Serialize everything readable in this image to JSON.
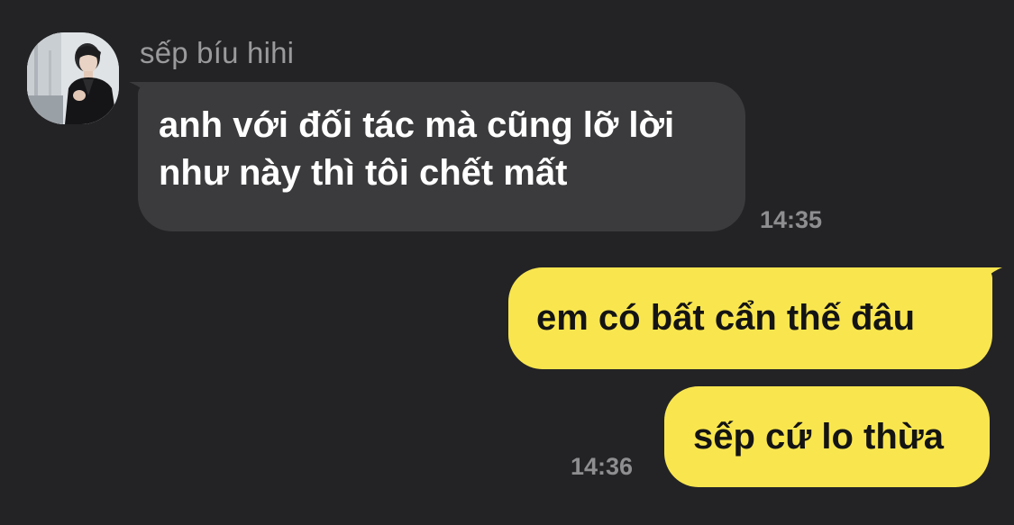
{
  "conversation": {
    "sender_name": "sếp bíu hihi",
    "messages": [
      {
        "direction": "incoming",
        "lines": [
          "anh với đối tác mà cũng lỡ lời",
          "như này thì tôi chết mất"
        ]
      },
      {
        "direction": "outgoing",
        "text": "em có bất cẩn thế đâu"
      },
      {
        "direction": "outgoing",
        "text": "sếp cứ lo thừa"
      }
    ],
    "timestamps": [
      "14:35",
      "14:36"
    ]
  },
  "colors": {
    "background": "#232325",
    "incoming_bubble": "#3b3b3d",
    "outgoing_bubble": "#f9e64f",
    "timestamp": "#8e8e90",
    "sender_name": "#9a9a9c"
  }
}
